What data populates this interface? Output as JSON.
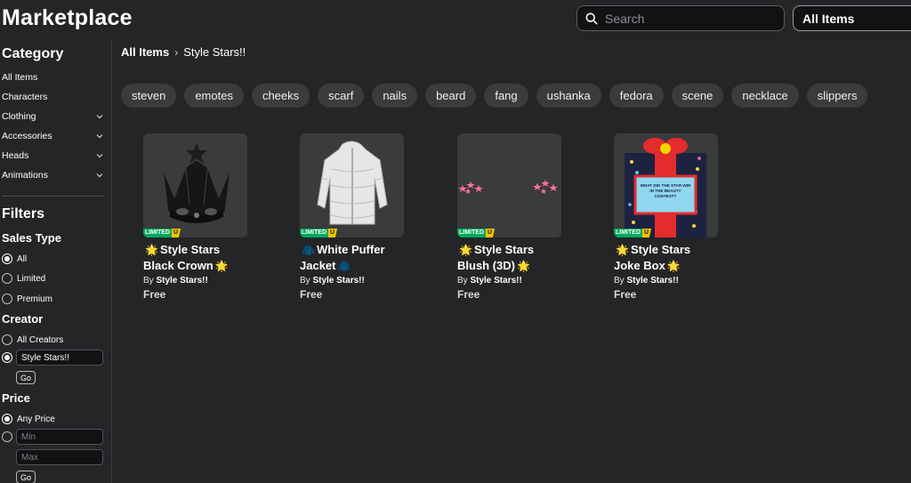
{
  "header": {
    "title": "Marketplace",
    "search_placeholder": "Search",
    "category_select": "All Items"
  },
  "sidebar": {
    "category_heading": "Category",
    "categories": [
      {
        "label": "All Items",
        "expandable": false
      },
      {
        "label": "Characters",
        "expandable": false
      },
      {
        "label": "Clothing",
        "expandable": true
      },
      {
        "label": "Accessories",
        "expandable": true
      },
      {
        "label": "Heads",
        "expandable": true
      },
      {
        "label": "Animations",
        "expandable": true
      }
    ],
    "filters_heading": "Filters",
    "sales_type": {
      "heading": "Sales Type",
      "options": [
        {
          "label": "All",
          "checked": true
        },
        {
          "label": "Limited",
          "checked": false
        },
        {
          "label": "Premium",
          "checked": false
        }
      ]
    },
    "creator": {
      "heading": "Creator",
      "all_label": "All Creators",
      "creator_value": "Style Stars!!",
      "go_label": "Go"
    },
    "price": {
      "heading": "Price",
      "any_label": "Any Price",
      "min_placeholder": "Min",
      "max_placeholder": "Max",
      "go_label": "Go"
    }
  },
  "breadcrumb": {
    "root": "All Items",
    "current": "Style Stars!!"
  },
  "chips": [
    "steven",
    "emotes",
    "cheeks",
    "scarf",
    "nails",
    "beard",
    "fang",
    "ushanka",
    "fedora",
    "scene",
    "necklace",
    "slippers"
  ],
  "items": [
    {
      "line1": "Style Stars",
      "line2": "Black Crown",
      "emoji": "🌟",
      "by": "By",
      "creator": "Style Stars!!",
      "price": "Free",
      "badge": "LIMITED",
      "badge_u": "U"
    },
    {
      "line1": "White Puffer",
      "line2": "Jacket",
      "emoji": "🧥",
      "by": "By",
      "creator": "Style Stars!!",
      "price": "Free",
      "badge": "LIMITED",
      "badge_u": "U"
    },
    {
      "line1": "Style Stars",
      "line2": "Blush (3D)",
      "emoji": "🌟",
      "by": "By",
      "creator": "Style Stars!!",
      "price": "Free",
      "badge": "LIMITED",
      "badge_u": "U"
    },
    {
      "line1": "Style Stars",
      "line2": "Joke Box",
      "emoji": "🌟",
      "by": "By",
      "creator": "Style Stars!!",
      "price": "Free",
      "badge": "LIMITED",
      "badge_u": "U",
      "box_text": "WHAT DID THE STAR WIN IN THE BEAUTY CONTEST?"
    }
  ],
  "colors": {
    "background": "#232527",
    "chip": "#393b3d",
    "limited_green": "#00a85a",
    "limited_yellow": "#f6c600"
  }
}
